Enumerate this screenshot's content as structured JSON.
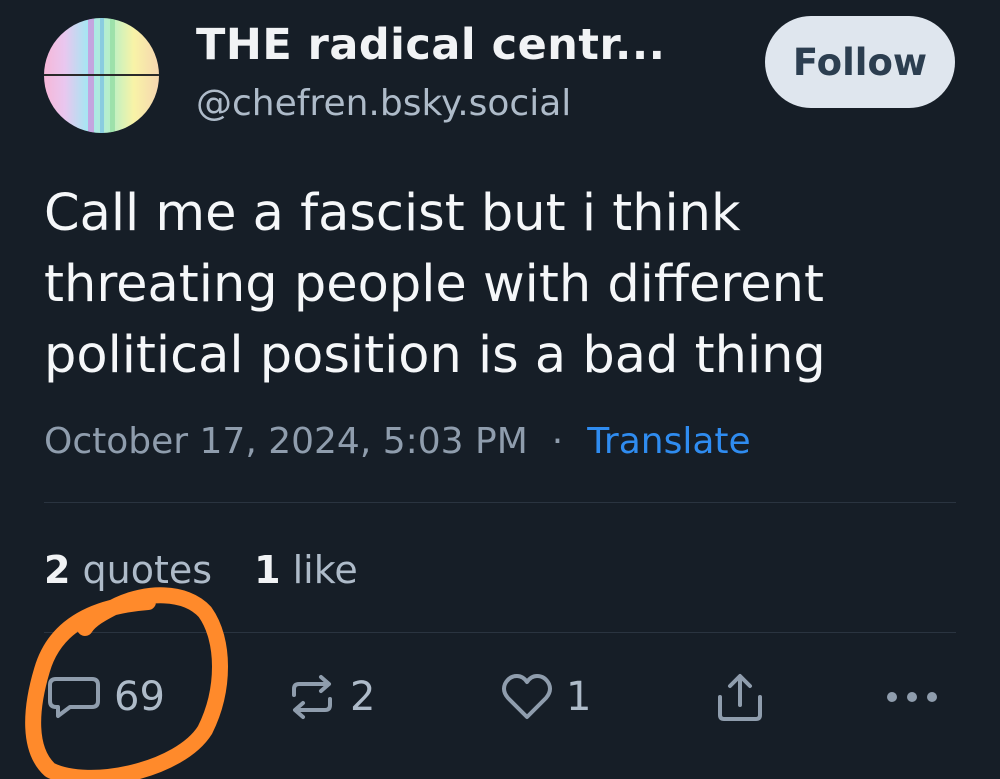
{
  "author": {
    "display_name": "THE radical centr...",
    "handle": "@chefren.bsky.social",
    "follow_label": "Follow"
  },
  "post": {
    "text_lines": [
      "Call me a fascist but i think",
      "threating people with different",
      "political position is a bad thing"
    ],
    "timestamp": "October 17, 2024, 5:03 PM",
    "separator": "·",
    "translate_label": "Translate"
  },
  "stats": {
    "quotes_count": "2",
    "quotes_label": "quotes",
    "likes_count": "1",
    "likes_label": "like"
  },
  "actions": {
    "reply_count": "69",
    "repost_count": "2",
    "like_count": "1"
  },
  "icons": {
    "reply": "reply-icon",
    "repost": "repost-icon",
    "like": "heart-icon",
    "share": "share-icon",
    "more": "more-icon"
  },
  "colors": {
    "background": "#161e27",
    "link": "#2f8cf0",
    "annotation": "#ff8a2b"
  }
}
